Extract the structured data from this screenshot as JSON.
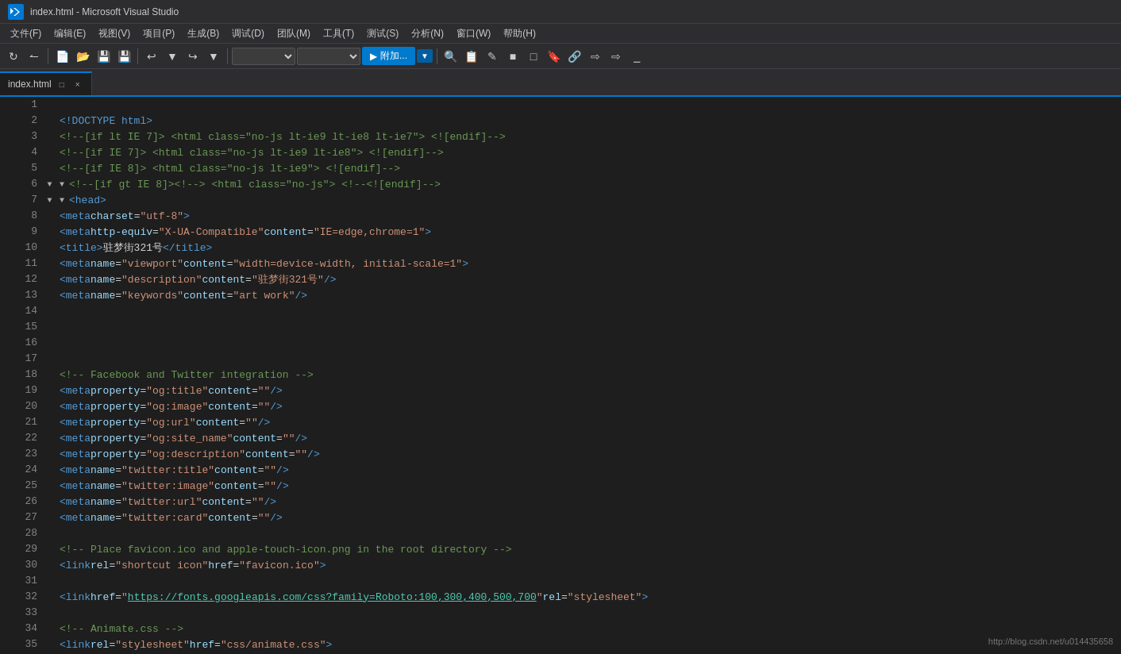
{
  "titleBar": {
    "icon": "VS",
    "title": "index.html - Microsoft Visual Studio"
  },
  "menuBar": {
    "items": [
      {
        "label": "文件(F)"
      },
      {
        "label": "编辑(E)"
      },
      {
        "label": "视图(V)"
      },
      {
        "label": "项目(P)"
      },
      {
        "label": "生成(B)"
      },
      {
        "label": "调试(D)"
      },
      {
        "label": "团队(M)"
      },
      {
        "label": "工具(T)"
      },
      {
        "label": "测试(S)"
      },
      {
        "label": "分析(N)"
      },
      {
        "label": "窗口(W)"
      },
      {
        "label": "帮助(H)"
      }
    ]
  },
  "tab": {
    "filename": "index.html",
    "pinIcon": "□",
    "closeIcon": "×"
  },
  "toolbar": {
    "attachLabel": "附加..."
  },
  "code": {
    "lines": [
      {
        "num": 1,
        "content": "",
        "html": ""
      },
      {
        "num": 2,
        "content": "    <!DOCTYPE html>",
        "html": "<span class='c-punct'>    </span><span class='c-tag'>&lt;!DOCTYPE html&gt;</span>"
      },
      {
        "num": 3,
        "content": "    <!--[if lt IE 7]>      <html class=\"no-js lt-ie9 lt-ie8 lt-ie7\"> <![endif]-->",
        "html": "<span class='c-text'>    </span><span class='c-comment'>&lt;!--[if lt IE 7]&gt;      &lt;html class=&quot;no-js lt-ie9 lt-ie8 lt-ie7&quot;&gt; &lt;![endif]--&gt;</span>"
      },
      {
        "num": 4,
        "content": "    <!--[if IE 7]>         <html class=\"no-js lt-ie9 lt-ie8\"> <![endif]-->",
        "html": "<span class='c-text'>    </span><span class='c-comment'>&lt;!--[if IE 7]&gt;         &lt;html class=&quot;no-js lt-ie9 lt-ie8&quot;&gt; &lt;![endif]--&gt;</span>"
      },
      {
        "num": 5,
        "content": "    <!--[if IE 8]>         <html class=\"no-js lt-ie9\"> <![endif]-->",
        "html": "<span class='c-text'>    </span><span class='c-comment'>&lt;!--[if IE 8]&gt;         &lt;html class=&quot;no-js lt-ie9&quot;&gt; &lt;![endif]--&gt;</span>"
      },
      {
        "num": 6,
        "content": "<!--[if gt IE 8]><!--> <html class=\"no-js\"> <!--<![endif]-->",
        "html": "<span class='fold-icon'>▼</span><span class='c-comment'>&lt;!--[if gt IE 8]&gt;&lt;!--&gt; &lt;html class=&quot;no-js&quot;&gt; &lt;!--&lt;![endif]--&gt;</span>"
      },
      {
        "num": 7,
        "content": "    <head>",
        "html": "<span class='c-text'>    </span><span class='fold-icon'>▼</span><span class='c-tag'>&lt;head&gt;</span>"
      },
      {
        "num": 8,
        "content": "        <meta charset=\"utf-8\">",
        "html": "<span class='c-text'>        </span><span class='c-tag'>&lt;meta</span> <span class='c-attr'>charset</span><span class='c-punct'>=</span><span class='c-string'>&quot;utf-8&quot;</span><span class='c-tag'>&gt;</span>"
      },
      {
        "num": 9,
        "content": "        <meta http-equiv=\"X-UA-Compatible\" content=\"IE=edge,chrome=1\">",
        "html": "<span class='c-text'>        </span><span class='c-tag'>&lt;meta</span> <span class='c-attr'>http-equiv</span><span class='c-punct'>=</span><span class='c-string'>&quot;X-UA-Compatible&quot;</span> <span class='c-attr'>content</span><span class='c-punct'>=</span><span class='c-string'>&quot;IE=edge,chrome=1&quot;</span><span class='c-tag'>&gt;</span>"
      },
      {
        "num": 10,
        "content": "        <title>驻梦街321号</title>",
        "html": "<span class='c-text'>        </span><span class='c-tag'>&lt;title&gt;</span><span class='c-chinese'>驻梦街321号</span><span class='c-tag'>&lt;/title&gt;</span>"
      },
      {
        "num": 11,
        "content": "        <meta name=\"viewport\" content=\"width=device-width, initial-scale=1\">",
        "html": "<span class='c-text'>        </span><span class='c-tag'>&lt;meta</span> <span class='c-attr'>name</span><span class='c-punct'>=</span><span class='c-string'>&quot;viewport&quot;</span> <span class='c-attr'>content</span><span class='c-punct'>=</span><span class='c-string'>&quot;width=device-width, initial-scale=1&quot;</span><span class='c-tag'>&gt;</span>"
      },
      {
        "num": 12,
        "content": "        <meta name=\"description\" content=\"驻梦街321号\" />",
        "html": "<span class='c-text'>        </span><span class='c-tag'>&lt;meta</span> <span class='c-attr'>name</span><span class='c-punct'>=</span><span class='c-string'>&quot;description&quot;</span> <span class='c-attr'>content</span><span class='c-punct'>=</span><span class='c-string'>&quot;驻梦街321号&quot;</span> <span class='c-tag'>/&gt;</span>"
      },
      {
        "num": 13,
        "content": "        <meta name=\"keywords\" content=\"art work\" />",
        "html": "<span class='c-text'>        </span><span class='c-tag'>&lt;meta</span> <span class='c-attr'>name</span><span class='c-punct'>=</span><span class='c-string'>&quot;keywords&quot;</span> <span class='c-attr'>content</span><span class='c-punct'>=</span><span class='c-string'>&quot;art work&quot;</span> <span class='c-tag'>/&gt;</span>"
      },
      {
        "num": 14,
        "content": "",
        "html": ""
      },
      {
        "num": 15,
        "content": "",
        "html": ""
      },
      {
        "num": 16,
        "content": "",
        "html": ""
      },
      {
        "num": 17,
        "content": "",
        "html": ""
      },
      {
        "num": 18,
        "content": "        <!-- Facebook and Twitter integration -->",
        "html": "<span class='c-text'>        </span><span class='c-comment'>&lt;!-- Facebook and Twitter integration --&gt;</span>"
      },
      {
        "num": 19,
        "content": "        <meta property=\"og:title\" content=\"\"/>",
        "html": "<span class='c-text'>        </span><span class='c-tag'>&lt;meta</span> <span class='c-attr'>property</span><span class='c-punct'>=</span><span class='c-string'>&quot;og:title&quot;</span> <span class='c-attr'>content</span><span class='c-punct'>=</span><span class='c-string'>&quot;&quot;</span><span class='c-tag'>/&gt;</span>"
      },
      {
        "num": 20,
        "content": "        <meta property=\"og:image\" content=\"\"/>",
        "html": "<span class='c-text'>        </span><span class='c-tag'>&lt;meta</span> <span class='c-attr'>property</span><span class='c-punct'>=</span><span class='c-string'>&quot;og:image&quot;</span> <span class='c-attr'>content</span><span class='c-punct'>=</span><span class='c-string'>&quot;&quot;</span><span class='c-tag'>/&gt;</span>"
      },
      {
        "num": 21,
        "content": "        <meta property=\"og:url\" content=\"\"/>",
        "html": "<span class='c-text'>        </span><span class='c-tag'>&lt;meta</span> <span class='c-attr'>property</span><span class='c-punct'>=</span><span class='c-string'>&quot;og:url&quot;</span> <span class='c-attr'>content</span><span class='c-punct'>=</span><span class='c-string'>&quot;&quot;</span><span class='c-tag'>/&gt;</span>"
      },
      {
        "num": 22,
        "content": "        <meta property=\"og:site_name\" content=\"\"/>",
        "html": "<span class='c-text'>        </span><span class='c-tag'>&lt;meta</span> <span class='c-attr'>property</span><span class='c-punct'>=</span><span class='c-string'>&quot;og:site_name&quot;</span> <span class='c-attr'>content</span><span class='c-punct'>=</span><span class='c-string'>&quot;&quot;</span><span class='c-tag'>/&gt;</span>"
      },
      {
        "num": 23,
        "content": "        <meta property=\"og:description\" content=\"\"/>",
        "html": "<span class='c-text'>        </span><span class='c-tag'>&lt;meta</span> <span class='c-attr'>property</span><span class='c-punct'>=</span><span class='c-string'>&quot;og:description&quot;</span> <span class='c-attr'>content</span><span class='c-punct'>=</span><span class='c-string'>&quot;&quot;</span><span class='c-tag'>/&gt;</span>"
      },
      {
        "num": 24,
        "content": "        <meta name=\"twitter:title\" content=\"\" />",
        "html": "<span class='c-text'>        </span><span class='c-tag'>&lt;meta</span> <span class='c-attr'>name</span><span class='c-punct'>=</span><span class='c-string'>&quot;twitter:title&quot;</span> <span class='c-attr'>content</span><span class='c-punct'>=</span><span class='c-string'>&quot;&quot;</span> <span class='c-tag'>/&gt;</span>"
      },
      {
        "num": 25,
        "content": "        <meta name=\"twitter:image\" content=\"\" />",
        "html": "<span class='c-text'>        </span><span class='c-tag'>&lt;meta</span> <span class='c-attr'>name</span><span class='c-punct'>=</span><span class='c-string'>&quot;twitter:image&quot;</span> <span class='c-attr'>content</span><span class='c-punct'>=</span><span class='c-string'>&quot;&quot;</span> <span class='c-tag'>/&gt;</span>"
      },
      {
        "num": 26,
        "content": "        <meta name=\"twitter:url\" content=\"\" />",
        "html": "<span class='c-text'>        </span><span class='c-tag'>&lt;meta</span> <span class='c-attr'>name</span><span class='c-punct'>=</span><span class='c-string'>&quot;twitter:url&quot;</span> <span class='c-attr'>content</span><span class='c-punct'>=</span><span class='c-string'>&quot;&quot;</span> <span class='c-tag'>/&gt;</span>"
      },
      {
        "num": 27,
        "content": "        <meta name=\"twitter:card\" content=\"\" />",
        "html": "<span class='c-text'>        </span><span class='c-tag'>&lt;meta</span> <span class='c-attr'>name</span><span class='c-punct'>=</span><span class='c-string'>&quot;twitter:card&quot;</span> <span class='c-attr'>content</span><span class='c-punct'>=</span><span class='c-string'>&quot;&quot;</span> <span class='c-tag'>/&gt;</span>"
      },
      {
        "num": 28,
        "content": "",
        "html": ""
      },
      {
        "num": 29,
        "content": "        <!-- Place favicon.ico and apple-touch-icon.png in the root directory -->",
        "html": "<span class='c-text'>        </span><span class='c-comment'>&lt;!-- Place favicon.ico and apple-touch-icon.png in the root directory --&gt;</span>"
      },
      {
        "num": 30,
        "content": "        <link rel=\"shortcut icon\" href=\"favicon.ico\">",
        "html": "<span class='c-text'>        </span><span class='c-tag'>&lt;link</span> <span class='c-attr'>rel</span><span class='c-punct'>=</span><span class='c-string'>&quot;shortcut icon&quot;</span> <span class='c-attr'>href</span><span class='c-punct'>=</span><span class='c-string'>&quot;favicon.ico&quot;</span><span class='c-tag'>&gt;</span>"
      },
      {
        "num": 31,
        "content": "",
        "html": ""
      },
      {
        "num": 32,
        "content": "        <link href=\"https://fonts.googleapis.com/css?family=Roboto:100,300,400,500,700\" rel=\"stylesheet\">",
        "html": "<span class='c-text'>        </span><span class='c-tag'>&lt;link</span> <span class='c-attr'>href</span><span class='c-punct'>=</span><span class='c-string'>&quot;</span><span class='c-link'>https://fonts.googleapis.com/css?family=Roboto:100,300,400,500,700</span><span class='c-string'>&quot;</span> <span class='c-attr'>rel</span><span class='c-punct'>=</span><span class='c-string'>&quot;stylesheet&quot;</span><span class='c-tag'>&gt;</span>"
      },
      {
        "num": 33,
        "content": "",
        "html": ""
      },
      {
        "num": 34,
        "content": "        <!-- Animate.css -->",
        "html": "<span class='c-text'>        </span><span class='c-comment'>&lt;!-- Animate.css --&gt;</span>"
      },
      {
        "num": 35,
        "content": "        <link rel=\"stylesheet\" href=\"css/animate.css\">",
        "html": "<span class='c-text'>        </span><span class='c-tag'>&lt;link</span> <span class='c-attr'>rel</span><span class='c-punct'>=</span><span class='c-string'>&quot;stylesheet&quot;</span> <span class='c-attr'>href</span><span class='c-punct'>=</span><span class='c-string'>&quot;css/animate.css&quot;</span><span class='c-tag'>&gt;</span>"
      }
    ]
  },
  "watermark": {
    "text": "http://blog.csdn.net/u014435658"
  }
}
